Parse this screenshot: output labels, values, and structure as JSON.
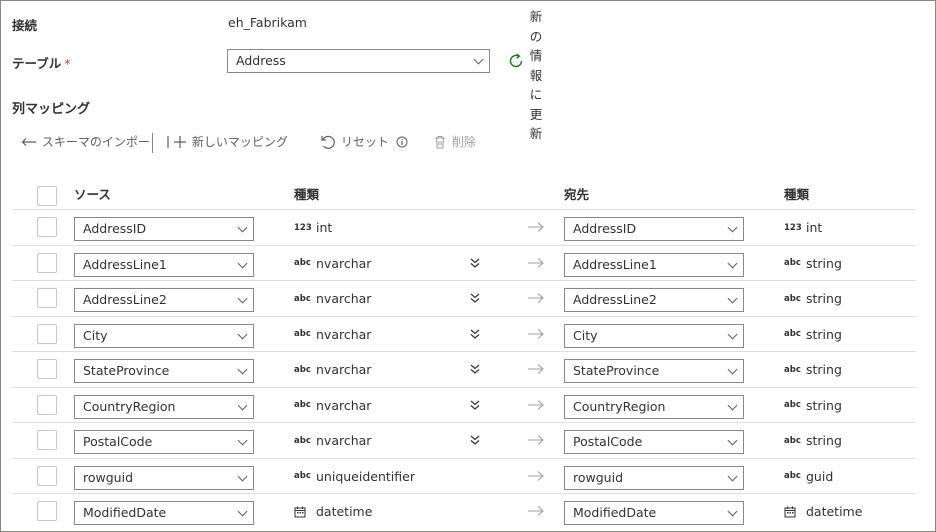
{
  "connection": {
    "label": "接続",
    "value": "eh_Fabrikam"
  },
  "table": {
    "label": "テーブル",
    "required_mark": "*",
    "selected": "Address",
    "refresh_label": "新\nの\n情\n報\nに\n更\n新"
  },
  "mapping": {
    "title": "列マッピング",
    "toolbar": {
      "import_label": "スキーマのインポー",
      "new_label": "新しいマッピング",
      "reset_label": "リセット",
      "delete_label": "削除"
    },
    "headers": {
      "source": "ソース",
      "source_type": "種類",
      "dest": "宛先",
      "dest_type": "種類"
    },
    "rows": [
      {
        "source": "AddressID",
        "source_icon": "123",
        "source_type": "int",
        "expandable": false,
        "dest": "AddressID",
        "dest_icon": "123",
        "dest_type": "int"
      },
      {
        "source": "AddressLine1",
        "source_icon": "abc",
        "source_type": "nvarchar",
        "expandable": true,
        "dest": "AddressLine1",
        "dest_icon": "abc",
        "dest_type": "string"
      },
      {
        "source": "AddressLine2",
        "source_icon": "abc",
        "source_type": "nvarchar",
        "expandable": true,
        "dest": "AddressLine2",
        "dest_icon": "abc",
        "dest_type": "string"
      },
      {
        "source": "City",
        "source_icon": "abc",
        "source_type": "nvarchar",
        "expandable": true,
        "dest": "City",
        "dest_icon": "abc",
        "dest_type": "string"
      },
      {
        "source": "StateProvince",
        "source_icon": "abc",
        "source_type": "nvarchar",
        "expandable": true,
        "dest": "StateProvince",
        "dest_icon": "abc",
        "dest_type": "string"
      },
      {
        "source": "CountryRegion",
        "source_icon": "abc",
        "source_type": "nvarchar",
        "expandable": true,
        "dest": "CountryRegion",
        "dest_icon": "abc",
        "dest_type": "string"
      },
      {
        "source": "PostalCode",
        "source_icon": "abc",
        "source_type": "nvarchar",
        "expandable": true,
        "dest": "PostalCode",
        "dest_icon": "abc",
        "dest_type": "string"
      },
      {
        "source": "rowguid",
        "source_icon": "abc",
        "source_type": "uniqueidentifier",
        "expandable": false,
        "dest": "rowguid",
        "dest_icon": "abc",
        "dest_type": "guid"
      },
      {
        "source": "ModifiedDate",
        "source_icon": "calendar-icon",
        "source_type": "datetime",
        "expandable": false,
        "dest": "ModifiedDate",
        "dest_icon": "calendar-icon",
        "dest_type": "datetime"
      }
    ]
  }
}
